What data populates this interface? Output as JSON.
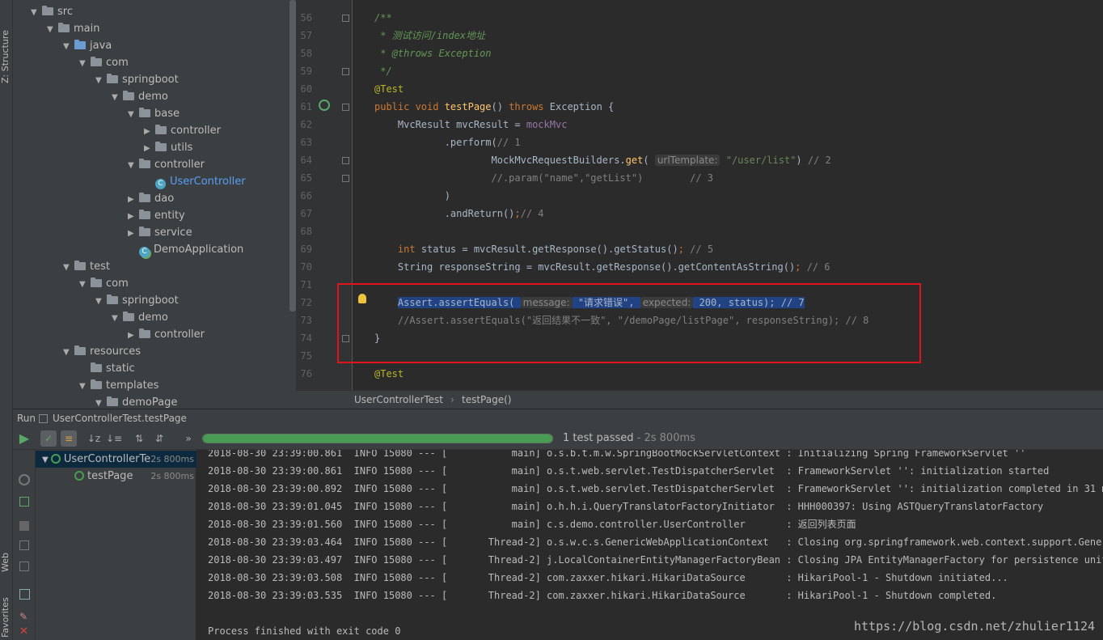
{
  "side_tabs": {
    "structure": "Z: Structure",
    "web": "Web",
    "favorites": "Favorites"
  },
  "project_tree": [
    {
      "label": "src",
      "depth": 0,
      "arrow": "▼",
      "icon": "folder",
      "blue": false
    },
    {
      "label": "main",
      "depth": 1,
      "arrow": "▼",
      "icon": "folder",
      "blue": false
    },
    {
      "label": "java",
      "depth": 2,
      "arrow": "▼",
      "icon": "src-folder",
      "blue": false
    },
    {
      "label": "com",
      "depth": 3,
      "arrow": "▼",
      "icon": "folder",
      "blue": false
    },
    {
      "label": "springboot",
      "depth": 4,
      "arrow": "▼",
      "icon": "folder",
      "blue": false
    },
    {
      "label": "demo",
      "depth": 5,
      "arrow": "▼",
      "icon": "folder",
      "blue": false
    },
    {
      "label": "base",
      "depth": 6,
      "arrow": "▼",
      "icon": "folder",
      "blue": false
    },
    {
      "label": "controller",
      "depth": 7,
      "arrow": "▶",
      "icon": "folder",
      "blue": false
    },
    {
      "label": "utils",
      "depth": 7,
      "arrow": "▶",
      "icon": "folder",
      "blue": false
    },
    {
      "label": "controller",
      "depth": 6,
      "arrow": "▼",
      "icon": "folder",
      "blue": false
    },
    {
      "label": "UserController",
      "depth": 7,
      "arrow": "",
      "icon": "class",
      "blue": true
    },
    {
      "label": "dao",
      "depth": 6,
      "arrow": "▶",
      "icon": "folder",
      "blue": false
    },
    {
      "label": "entity",
      "depth": 6,
      "arrow": "▶",
      "icon": "folder",
      "blue": false
    },
    {
      "label": "service",
      "depth": 6,
      "arrow": "▶",
      "icon": "folder",
      "blue": false
    },
    {
      "label": "DemoApplication",
      "depth": 6,
      "arrow": "",
      "icon": "app",
      "blue": false
    },
    {
      "label": "test",
      "depth": 2,
      "arrow": "▼",
      "icon": "folder",
      "blue": false
    },
    {
      "label": "com",
      "depth": 3,
      "arrow": "▼",
      "icon": "folder",
      "blue": false
    },
    {
      "label": "springboot",
      "depth": 4,
      "arrow": "▼",
      "icon": "folder",
      "blue": false
    },
    {
      "label": "demo",
      "depth": 5,
      "arrow": "▼",
      "icon": "folder",
      "blue": false
    },
    {
      "label": "controller",
      "depth": 6,
      "arrow": "▶",
      "icon": "folder",
      "blue": false
    },
    {
      "label": "resources",
      "depth": 2,
      "arrow": "▼",
      "icon": "folder",
      "blue": false
    },
    {
      "label": "static",
      "depth": 3,
      "arrow": "",
      "icon": "folder",
      "blue": false
    },
    {
      "label": "templates",
      "depth": 3,
      "arrow": "▼",
      "icon": "folder",
      "blue": false
    },
    {
      "label": "demoPage",
      "depth": 4,
      "arrow": "▼",
      "icon": "folder",
      "blue": false
    }
  ],
  "editor": {
    "line_numbers": [
      "56",
      "57",
      "58",
      "59",
      "60",
      "61",
      "62",
      "63",
      "64",
      "65",
      "66",
      "67",
      "68",
      "69",
      "70",
      "71",
      "72",
      "73",
      "74",
      "75",
      "76"
    ],
    "lines": [
      [
        {
          "t": "/**",
          "c": "doc"
        }
      ],
      [
        {
          "t": " * 测试访问/index地址",
          "c": "doc"
        }
      ],
      [
        {
          "t": " * ",
          "c": "doc"
        },
        {
          "t": "@throws",
          "c": "doc"
        },
        {
          "t": " Exception",
          "c": "doc"
        }
      ],
      [
        {
          "t": " */",
          "c": "doc"
        }
      ],
      [
        {
          "t": "@Test",
          "c": "ann"
        }
      ],
      [
        {
          "t": "public void ",
          "c": "kw"
        },
        {
          "t": "testPage",
          "c": "fn"
        },
        {
          "t": "() ",
          "c": ""
        },
        {
          "t": "throws ",
          "c": "kw"
        },
        {
          "t": "Exception {",
          "c": ""
        }
      ],
      [
        {
          "t": "    MvcResult mvcResult = ",
          "c": ""
        },
        {
          "t": "mockMvc",
          "c": "fld"
        }
      ],
      [
        {
          "t": "            .perform(",
          "c": ""
        },
        {
          "t": "// 1",
          "c": "cm"
        }
      ],
      [
        {
          "t": "                    MockMvcRequestBuilders.",
          "c": ""
        },
        {
          "t": "get",
          "c": "fn"
        },
        {
          "t": "( ",
          "c": ""
        },
        {
          "t": "urlTemplate:",
          "c": "hint"
        },
        {
          "t": " ",
          "c": ""
        },
        {
          "t": "\"/user/list\"",
          "c": "str"
        },
        {
          "t": ") ",
          "c": ""
        },
        {
          "t": "// 2",
          "c": "cm"
        }
      ],
      [
        {
          "t": "                    //.param(\"name\",\"getList\")        // 3",
          "c": "cm"
        }
      ],
      [
        {
          "t": "            )",
          "c": ""
        }
      ],
      [
        {
          "t": "            .andReturn()",
          "c": ""
        },
        {
          "t": ";",
          "c": "kw"
        },
        {
          "t": "// 4",
          "c": "cm"
        }
      ],
      [],
      [
        {
          "t": "    ",
          "c": ""
        },
        {
          "t": "int ",
          "c": "kw"
        },
        {
          "t": "status = mvcResult.getResponse().getStatus()",
          "c": ""
        },
        {
          "t": "; ",
          "c": "kw"
        },
        {
          "t": "// 5",
          "c": "cm"
        }
      ],
      [
        {
          "t": "    String responseString = mvcResult.getResponse().getContentAsString()",
          "c": ""
        },
        {
          "t": "; ",
          "c": "kw"
        },
        {
          "t": "// 6",
          "c": "cm"
        }
      ],
      [],
      [
        {
          "t": "    ",
          "c": ""
        },
        {
          "t": "Assert.assertEquals( ",
          "c": "sel"
        },
        {
          "t": "message:",
          "c": "hint"
        },
        {
          "t": " \"请求错误\", ",
          "c": "sel"
        },
        {
          "t": "expected:",
          "c": "hint"
        },
        {
          "t": " 200, status); // 7",
          "c": "sel"
        }
      ],
      [
        {
          "t": "    //Assert.assertEquals(\"返回结果不一致\", \"/demoPage/listPage\", responseString); // 8",
          "c": "cm"
        }
      ],
      [
        {
          "t": "}",
          "c": ""
        }
      ],
      [],
      [
        {
          "t": "@Test",
          "c": "ann"
        }
      ]
    ]
  },
  "breadcrumb": {
    "file": "UserControllerTest",
    "method": "testPage()"
  },
  "run": {
    "title_prefix": "Run",
    "config": "UserControllerTest.testPage",
    "progress": 1.0,
    "status": "1 test passed",
    "duration": " - 2s 800ms",
    "toolbar_more": "»"
  },
  "tests": [
    {
      "name": "UserControllerTe",
      "time": "2s 800ms",
      "selected": true,
      "indent": 0
    },
    {
      "name": "testPage",
      "time": "2s 800ms",
      "selected": false,
      "indent": 1
    }
  ],
  "console": {
    "lines": [
      "2018-08-30 23:39:00.861  INFO 15080 --- [           main] o.s.b.t.m.w.SpringBootMockServletContext : Initializing Spring FrameworkServlet ''",
      "2018-08-30 23:39:00.861  INFO 15080 --- [           main] o.s.t.web.servlet.TestDispatcherServlet  : FrameworkServlet '': initialization started",
      "2018-08-30 23:39:00.892  INFO 15080 --- [           main] o.s.t.web.servlet.TestDispatcherServlet  : FrameworkServlet '': initialization completed in 31 ms",
      "2018-08-30 23:39:01.045  INFO 15080 --- [           main] o.h.h.i.QueryTranslatorFactoryInitiator  : HHH000397: Using ASTQueryTranslatorFactory",
      "2018-08-30 23:39:01.560  INFO 15080 --- [           main] c.s.demo.controller.UserController       : 返回列表页面",
      "2018-08-30 23:39:03.464  INFO 15080 --- [       Thread-2] o.s.w.c.s.GenericWebApplicationContext   : Closing org.springframework.web.context.support.GenericWe",
      "2018-08-30 23:39:03.497  INFO 15080 --- [       Thread-2] j.LocalContainerEntityManagerFactoryBean : Closing JPA EntityManagerFactory for persistence unit 'def",
      "2018-08-30 23:39:03.508  INFO 15080 --- [       Thread-2] com.zaxxer.hikari.HikariDataSource       : HikariPool-1 - Shutdown initiated...",
      "2018-08-30 23:39:03.535  INFO 15080 --- [       Thread-2] com.zaxxer.hikari.HikariDataSource       : HikariPool-1 - Shutdown completed.",
      "",
      "Process finished with exit code 0"
    ],
    "watermark": "https://blog.csdn.net/zhulier1124"
  },
  "colors": {
    "pass": "#499c54",
    "highlight_box": "#e0141a",
    "selection": "#214283"
  },
  "icons": {
    "run": "play-icon",
    "rerun": "rerun-icon",
    "stop": "stop-icon",
    "pass": "check-circle-icon",
    "bulb": "lightbulb-icon"
  }
}
